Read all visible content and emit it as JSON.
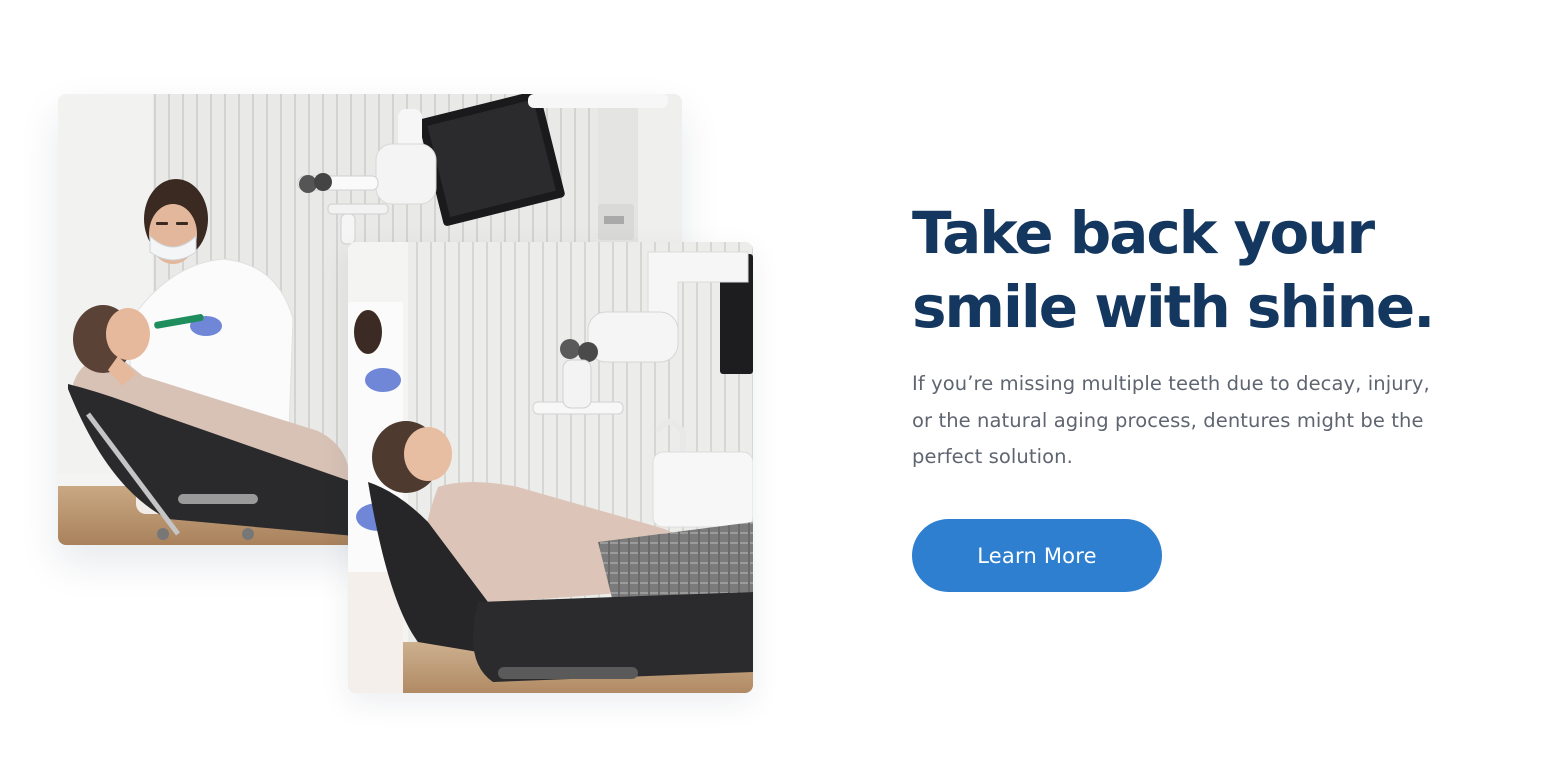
{
  "hero": {
    "headline": "Take back your\nsmile with shine.",
    "description": "If you’re missing multiple teeth due to decay, injury,\nor the natural aging process, dentures might be the\nperfect solution.",
    "cta_label": "Learn More"
  },
  "images": {
    "back_photo": "dentist-examining-patient-photo",
    "front_photo": "patient-in-dental-chair-photo"
  },
  "colors": {
    "headline": "#14375f",
    "body_text": "#5f6570",
    "button": "#2f7fd1",
    "button_text": "#ffffff"
  }
}
